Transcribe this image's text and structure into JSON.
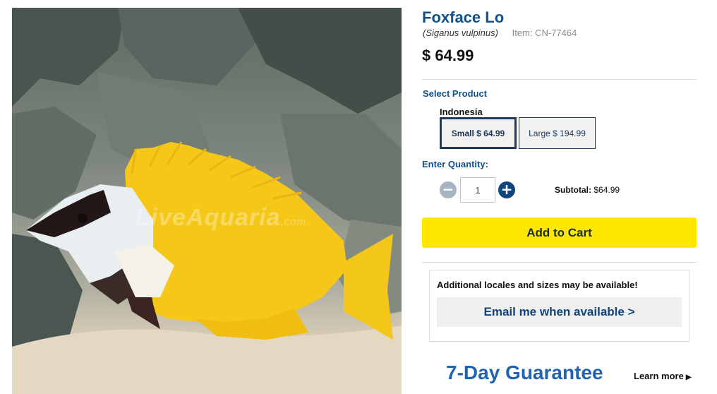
{
  "product": {
    "name": "Foxface Lo",
    "scientific_name": "(Siganus vulpinus)",
    "item_label": "Item: CN-77464",
    "price": "$ 64.99",
    "image_watermark": "LiveAquaria",
    "image_watermark_suffix": ".com"
  },
  "select_product": {
    "heading": "Select Product",
    "locale": "Indonesia",
    "options": [
      {
        "label": "Small $ 64.99",
        "selected": true
      },
      {
        "label": "Large $ 194.99",
        "selected": false
      }
    ]
  },
  "quantity": {
    "heading": "Enter Quantity:",
    "value": "1",
    "minus_icon": "minus-circle-icon",
    "plus_icon": "plus-circle-icon",
    "subtotal_label": "Subtotal:",
    "subtotal_value": "$64.99"
  },
  "cart": {
    "button_label": "Add to Cart"
  },
  "notify": {
    "message": "Additional locales and sizes may be available!",
    "button_label": "Email me when available >"
  },
  "guarantee": {
    "title": "7-Day Guarantee",
    "link_label": "Learn more"
  },
  "colors": {
    "title_blue": "#10528c",
    "cart_yellow": "#ffe800",
    "guarantee_blue": "#1f63b5"
  }
}
